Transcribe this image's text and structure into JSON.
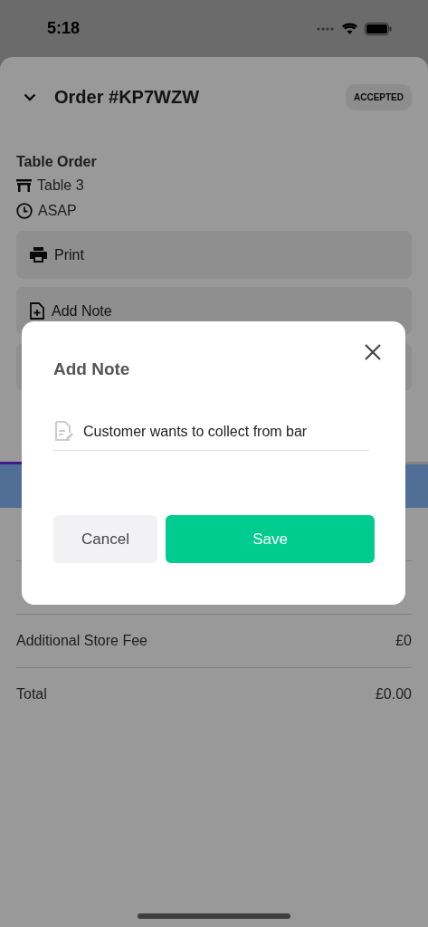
{
  "status_bar": {
    "time": "5:18"
  },
  "order": {
    "title": "Order #KP7WZW",
    "status": "ACCEPTED",
    "type": "Table Order",
    "table": "Table 3",
    "timing": "ASAP"
  },
  "actions": [
    {
      "kind": "print",
      "label": "Print"
    },
    {
      "kind": "note",
      "label": "Add Note"
    },
    {
      "kind": "hidden"
    }
  ],
  "summary_rows": [
    {
      "kind": "covered"
    },
    {
      "kind": "covered"
    },
    {
      "kind": "fee",
      "label": "Additional Store Fee",
      "amount": "£0"
    },
    {
      "kind": "fee",
      "label": "Total",
      "amount": "£0.00"
    }
  ],
  "dialog": {
    "title": "Add Note",
    "note": {
      "value": "Customer wants to collect from bar"
    },
    "buttons": [
      {
        "kind": "secondary",
        "label": "Cancel"
      },
      {
        "kind": "primary",
        "label": "Save"
      }
    ]
  }
}
